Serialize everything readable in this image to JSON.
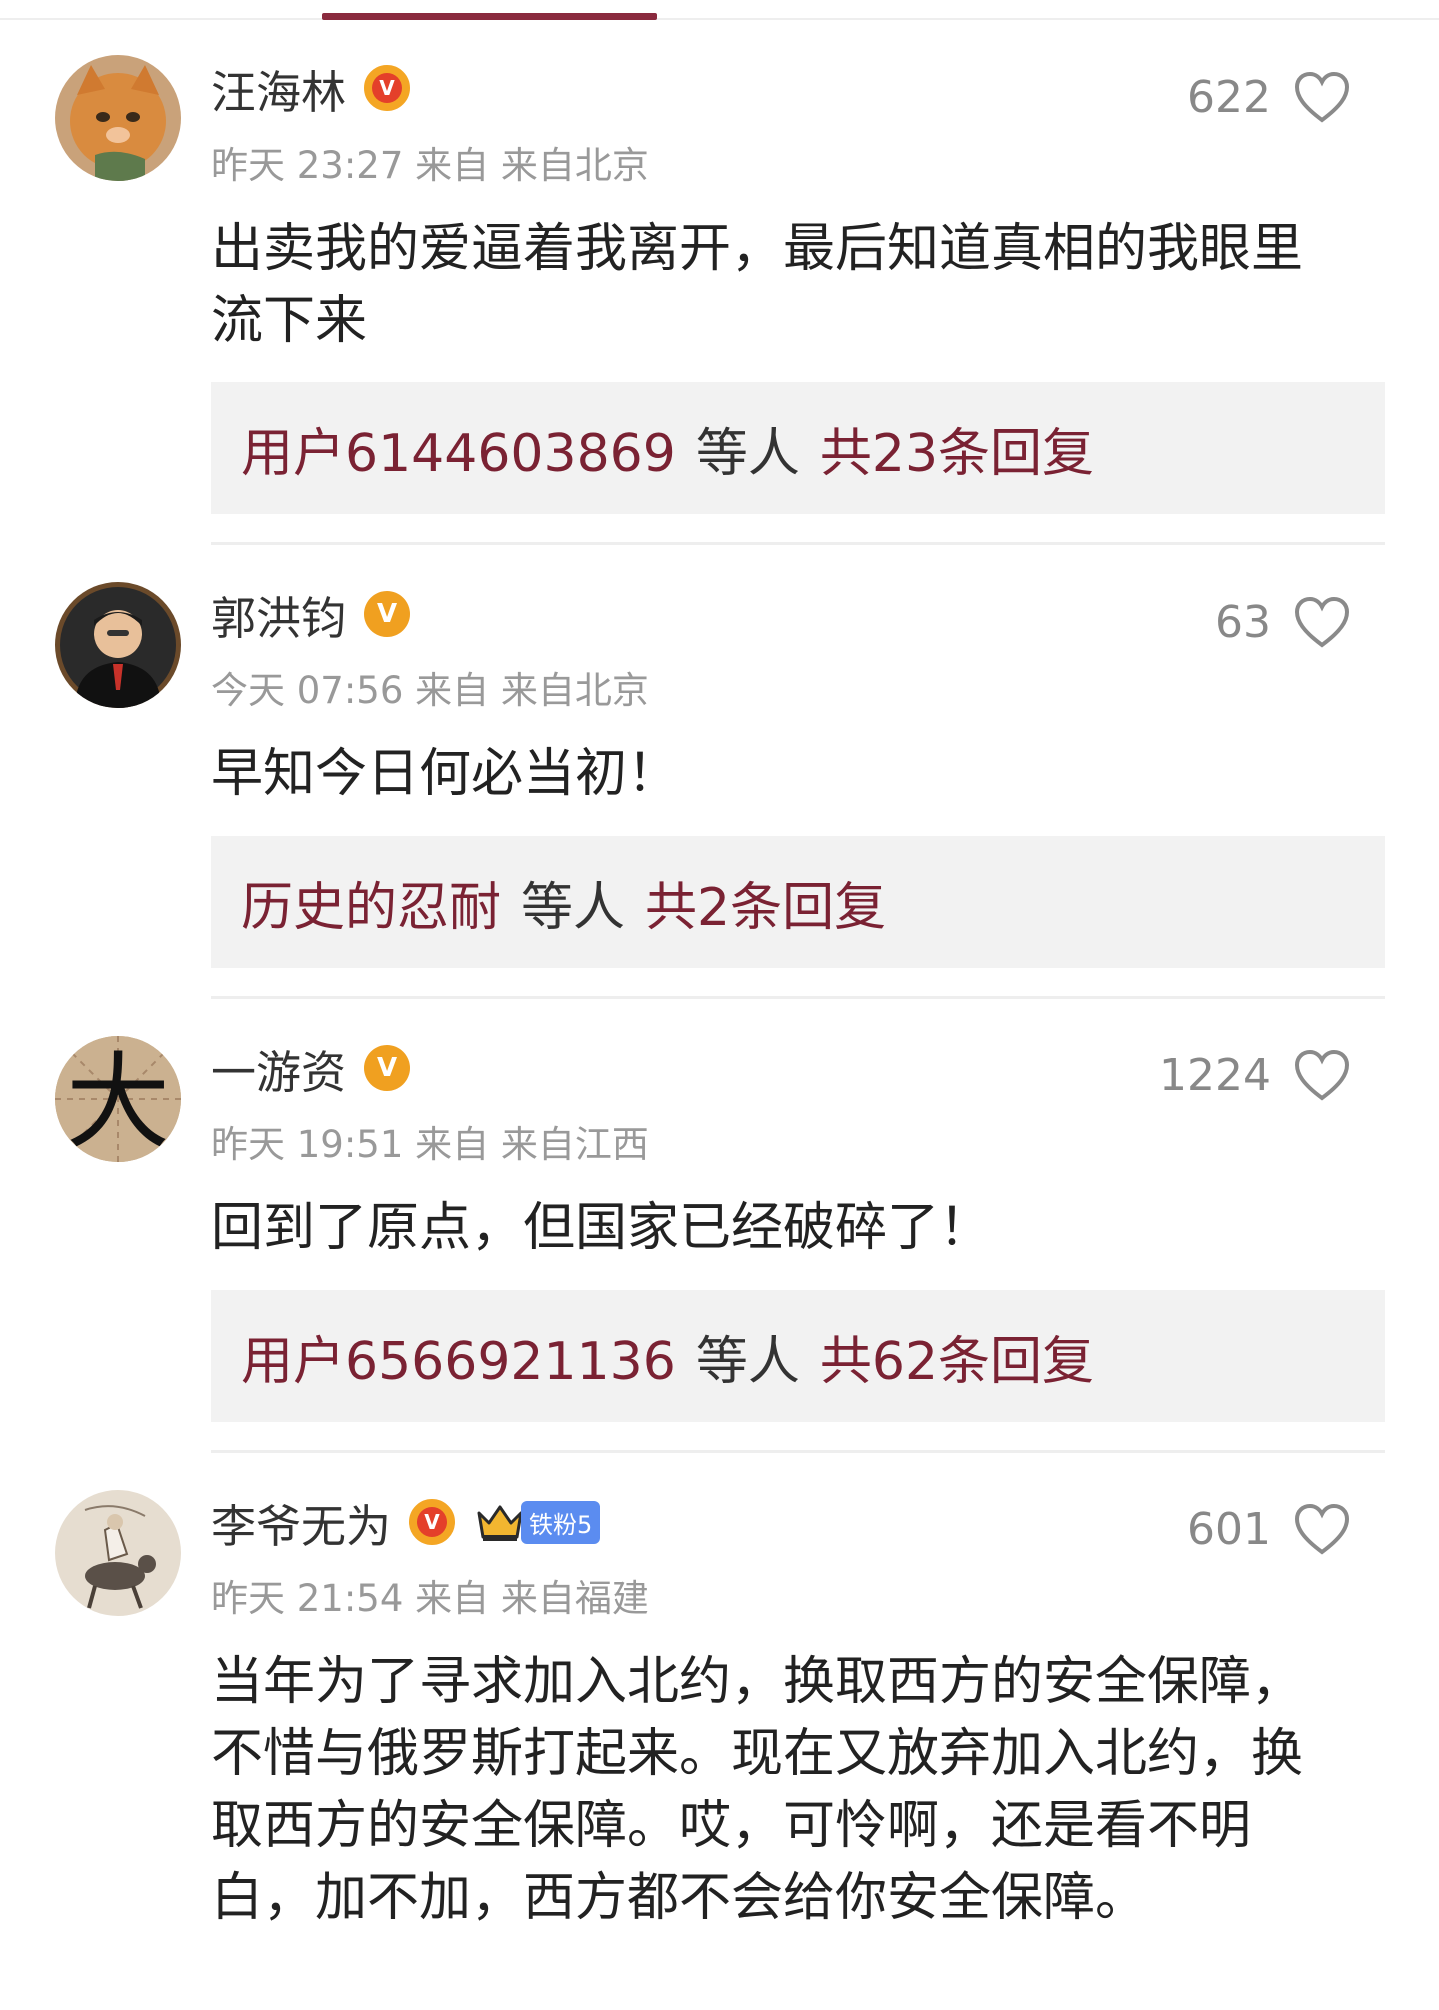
{
  "comments": [
    {
      "name": "汪海林",
      "badge": "V",
      "time": "昨天 23:27 来自 来自北京",
      "likes": "622",
      "text": "出卖我的爱逼着我离开，最后知道真相的我眼里流下来",
      "reply_user": "用户6144603869",
      "reply_mid": "等人",
      "reply_total": "共23条回复"
    },
    {
      "name": "郭洪钧",
      "badge": "V",
      "time": "今天 07:56 来自 来自北京",
      "likes": "63",
      "text": "早知今日何必当初！",
      "reply_user": "历史的忍耐",
      "reply_mid": "等人",
      "reply_total": "共2条回复"
    },
    {
      "name": "一游资",
      "badge": "V",
      "avatar_char": "大",
      "time": "昨天 19:51 来自 来自江西",
      "likes": "1224",
      "text": "回到了原点，但国家已经破碎了！",
      "reply_user": "用户6566921136",
      "reply_mid": "等人",
      "reply_total": "共62条回复"
    },
    {
      "name": "李爷无为",
      "badge": "V",
      "fan_label": "铁粉5",
      "time": "昨天 21:54 来自 来自福建",
      "likes": "601",
      "text": "当年为了寻求加入北约，换取西方的安全保障，不惜与俄罗斯打起来。现在又放弃加入北约，换取西方的安全保障。哎，可怜啊，还是看不明白，加不加，西方都不会给你安全保障。"
    }
  ],
  "colors": {
    "accent": "#7a2233",
    "tab_indicator": "#8a2a3e",
    "verified_orange": "#f0a020",
    "verified_red": "#e4402a",
    "fan_badge": "#5b8cf0"
  }
}
